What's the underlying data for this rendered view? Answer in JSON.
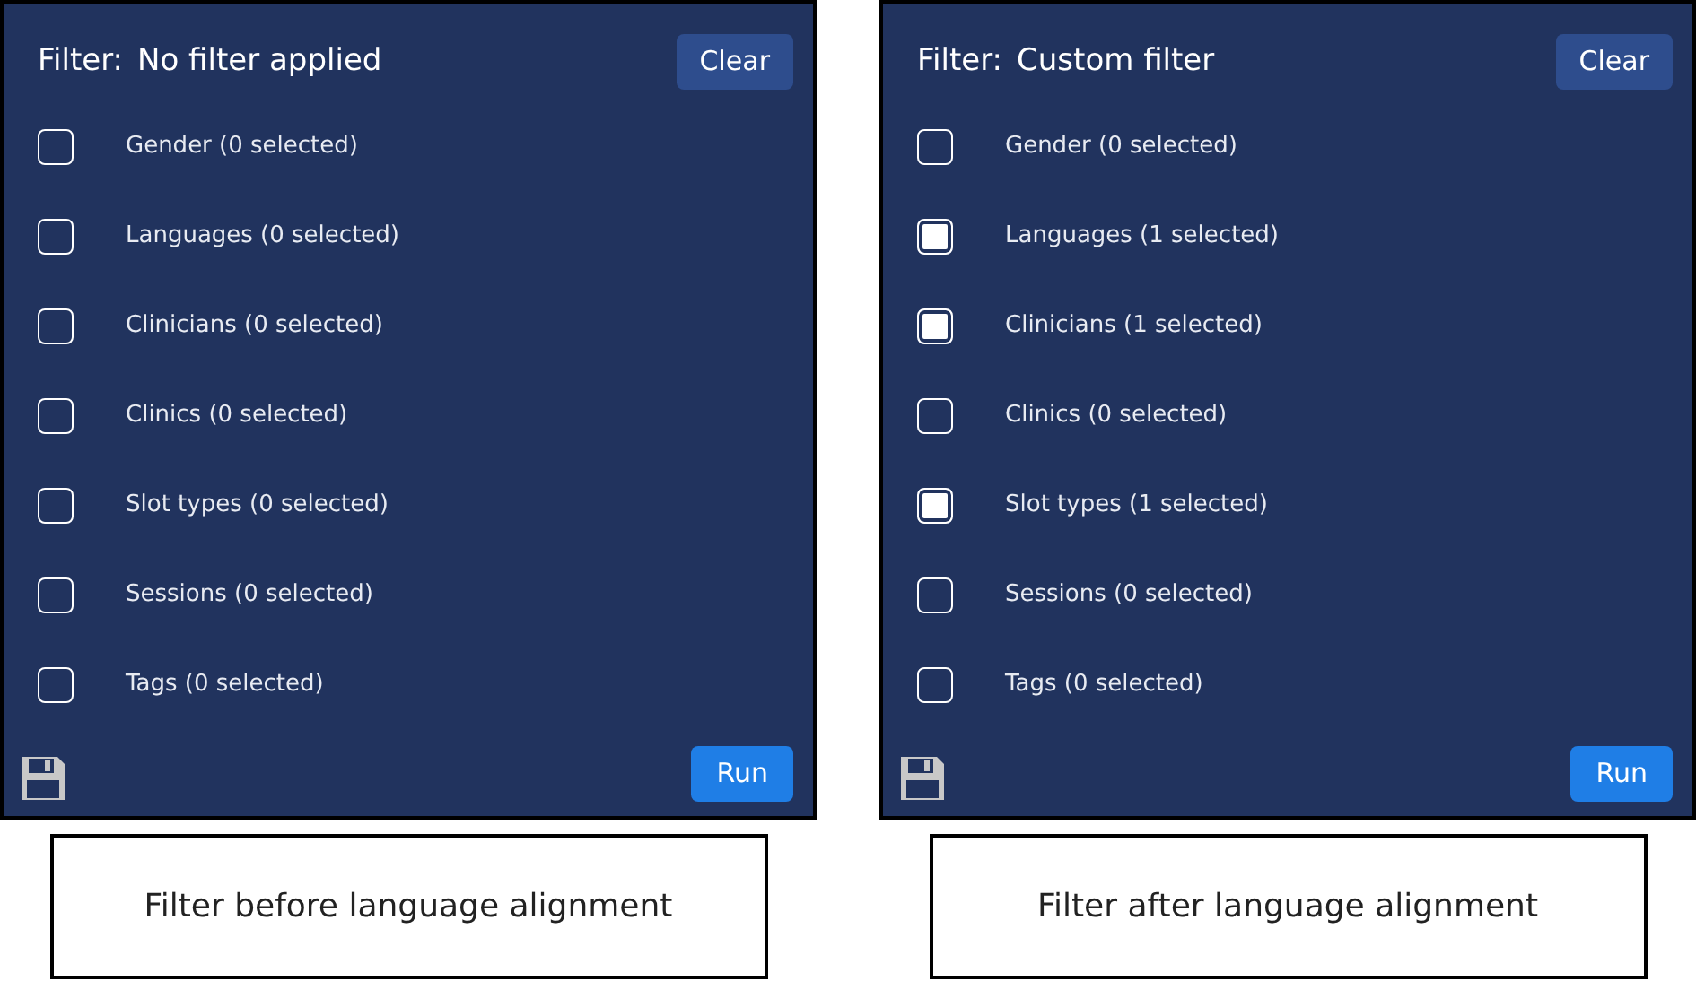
{
  "panels": [
    {
      "filter_label": "Filter:",
      "filter_value": "No filter applied",
      "clear_button": "Clear",
      "run_button": "Run",
      "caption": "Filter before language alignment",
      "options": [
        {
          "label": "Gender (0 selected)",
          "checked": false
        },
        {
          "label": "Languages (0 selected)",
          "checked": false
        },
        {
          "label": "Clinicians (0 selected)",
          "checked": false
        },
        {
          "label": "Clinics (0 selected)",
          "checked": false
        },
        {
          "label": "Slot types (0 selected)",
          "checked": false
        },
        {
          "label": "Sessions (0 selected)",
          "checked": false
        },
        {
          "label": "Tags (0 selected)",
          "checked": false
        }
      ]
    },
    {
      "filter_label": "Filter:",
      "filter_value": "Custom filter",
      "clear_button": "Clear",
      "run_button": "Run",
      "caption": "Filter after language alignment",
      "options": [
        {
          "label": "Gender (0 selected)",
          "checked": false
        },
        {
          "label": "Languages (1 selected)",
          "checked": true
        },
        {
          "label": "Clinicians (1 selected)",
          "checked": true
        },
        {
          "label": "Clinics (0 selected)",
          "checked": false
        },
        {
          "label": "Slot types (1 selected)",
          "checked": true
        },
        {
          "label": "Sessions (0 selected)",
          "checked": false
        },
        {
          "label": "Tags (0 selected)",
          "checked": false
        }
      ]
    }
  ]
}
